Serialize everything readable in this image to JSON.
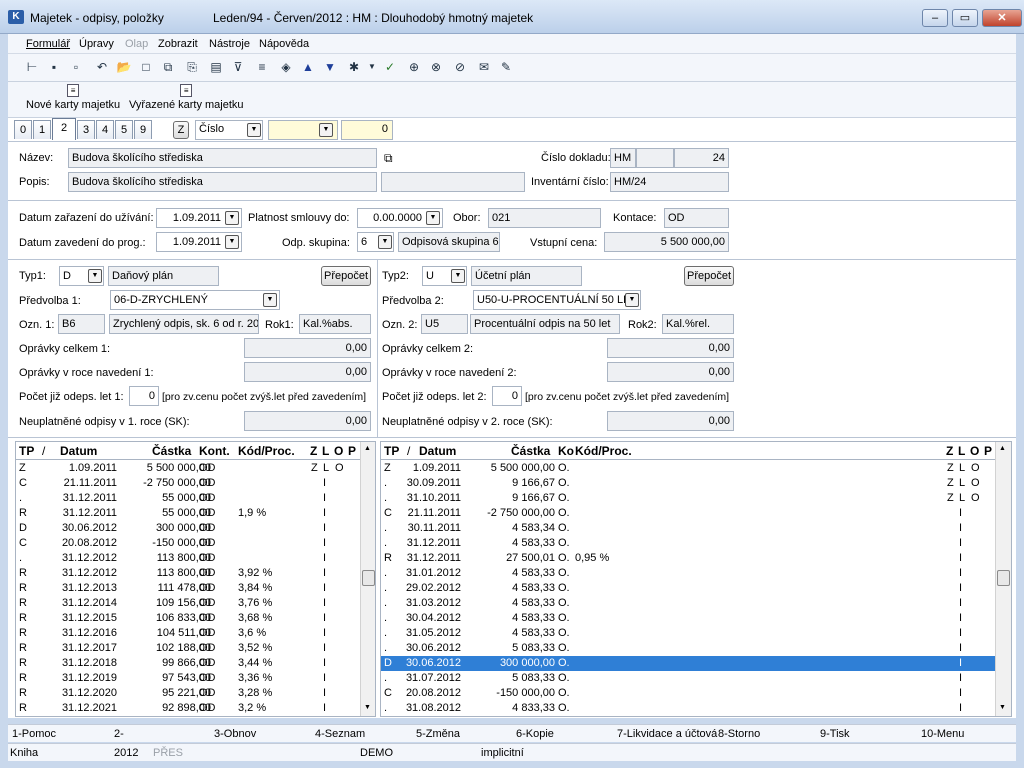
{
  "window": {
    "title": "Majetek - odpisy, položky",
    "subtitle": "Leden/94 - Červen/2012 : HM : Dlouhodobý hmotný majetek"
  },
  "menu": [
    "Formulář",
    "Úpravy",
    "Olap",
    "Zobrazit",
    "Nástroje",
    "Nápověda"
  ],
  "toolbar2": {
    "new_cards": "Nové karty majetku",
    "removed_cards": "Vyřazené karty majetku"
  },
  "tabs": [
    "0",
    "1",
    "2",
    "3",
    "4",
    "5",
    "9"
  ],
  "sortbar": {
    "z_button": "Z",
    "sort_field": "Číslo",
    "value": "0"
  },
  "header": {
    "nazev_label": "Název:",
    "nazev": "Budova školícího střediska",
    "popis_label": "Popis:",
    "popis": "Budova školícího střediska",
    "cislo_dokladu_label": "Číslo dokladu:",
    "cislo_dokladu_rada": "HM",
    "cislo_dokladu": "24",
    "inv_cislo_label": "Inventární číslo:",
    "inv_cislo": "HM/24"
  },
  "dates": {
    "zarazeni_label": "Datum zařazení do užívání:",
    "zarazeni": "1.09.2011",
    "zavedeni_label": "Datum zavedení do prog.:",
    "zavedeni": "1.09.2011",
    "platnost_label": "Platnost smlouvy do:",
    "platnost": "0.00.0000",
    "odp_skupina_label": "Odp. skupina:",
    "odp_skupina": "6",
    "odp_skupina_text": "Odpisová skupina 6 (",
    "obor_label": "Obor:",
    "obor": "021",
    "kontace_label": "Kontace:",
    "kontace": "OD",
    "vstupni_cena_label": "Vstupní cena:",
    "vstupni_cena": "5 500 000,00"
  },
  "plan1": {
    "typ_label": "Typ1:",
    "typ": "D",
    "typ_text": "Daňový plán",
    "prepocet": "Přepočet",
    "predvolba_label": "Předvolba 1:",
    "predvolba": "06-D-ZRYCHLENÝ",
    "ozn_label": "Ozn. 1:",
    "ozn": "B6",
    "ozn_text": "Zrychlený odpis, sk. 6 od r. 20",
    "rok_label": "Rok1:",
    "rok": "Kal.%abs.",
    "opravky_celkem_label": "Oprávky celkem 1:",
    "opravky_celkem": "0,00",
    "opravky_roce_label": "Oprávky v roce navedení 1:",
    "opravky_roce": "0,00",
    "pocet_let_label": "Počet již odeps. let 1:",
    "pocet_let": "0",
    "pocet_let_note": "[pro zv.cenu počet zvýš.let před zavedením]",
    "neuplatnene_label": "Neuplatněné odpisy v 1. roce (SK):",
    "neuplatnene": "0,00"
  },
  "plan2": {
    "typ_label": "Typ2:",
    "typ": "U",
    "typ_text": "Účetní plán",
    "prepocet": "Přepočet",
    "predvolba_label": "Předvolba 2:",
    "predvolba": "U50-U-PROCENTUÁLNÍ 50 LET",
    "ozn_label": "Ozn. 2:",
    "ozn": "U5",
    "ozn_text": "Procentuální odpis na 50 let",
    "rok_label": "Rok2:",
    "rok": "Kal.%rel.",
    "opravky_celkem_label": "Oprávky celkem 2:",
    "opravky_celkem": "0,00",
    "opravky_roce_label": "Oprávky v roce navedení 2:",
    "opravky_roce": "0,00",
    "pocet_let_label": "Počet již odeps. let 2:",
    "pocet_let": "0",
    "pocet_let_note": "[pro zv.cenu počet zvýš.let před zavedením]",
    "neuplatnene_label": "Neuplatněné odpisy v 2. roce (SK):",
    "neuplatnene": "0,00"
  },
  "grid1": {
    "columns": [
      "TP",
      "/",
      "Datum",
      "Částka",
      "Kont.",
      "Kód/Proc.",
      "Z",
      "L",
      "O",
      "P"
    ],
    "rows": [
      [
        "Z",
        "1.09.2011",
        "5 500 000,00",
        "OD",
        "",
        "Z",
        "L",
        "O",
        ""
      ],
      [
        "C",
        "21.11.2011",
        "-2 750 000,00",
        "OD",
        "",
        "",
        "I",
        "",
        ""
      ],
      [
        ".",
        "31.12.2011",
        "55 000,00",
        "OD",
        "",
        "",
        "I",
        "",
        ""
      ],
      [
        "R",
        "31.12.2011",
        "55 000,00",
        "OD",
        "1,9 %",
        "",
        "I",
        "",
        ""
      ],
      [
        "D",
        "30.06.2012",
        "300 000,00",
        "OD",
        "",
        "",
        "I",
        "",
        ""
      ],
      [
        "C",
        "20.08.2012",
        "-150 000,00",
        "OD",
        "",
        "",
        "I",
        "",
        ""
      ],
      [
        ".",
        "31.12.2012",
        "113 800,00",
        "OD",
        "",
        "",
        "I",
        "",
        ""
      ],
      [
        "R",
        "31.12.2012",
        "113 800,00",
        "OD",
        "3,92 %",
        "",
        "I",
        "",
        ""
      ],
      [
        "R",
        "31.12.2013",
        "111 478,00",
        "OD",
        "3,84 %",
        "",
        "I",
        "",
        ""
      ],
      [
        "R",
        "31.12.2014",
        "109 156,00",
        "OD",
        "3,76 %",
        "",
        "I",
        "",
        ""
      ],
      [
        "R",
        "31.12.2015",
        "106 833,00",
        "OD",
        "3,68 %",
        "",
        "I",
        "",
        ""
      ],
      [
        "R",
        "31.12.2016",
        "104 511,00",
        "OD",
        "3,6 %",
        "",
        "I",
        "",
        ""
      ],
      [
        "R",
        "31.12.2017",
        "102 188,00",
        "OD",
        "3,52 %",
        "",
        "I",
        "",
        ""
      ],
      [
        "R",
        "31.12.2018",
        "99 866,00",
        "OD",
        "3,44 %",
        "",
        "I",
        "",
        ""
      ],
      [
        "R",
        "31.12.2019",
        "97 543,00",
        "OD",
        "3,36 %",
        "",
        "I",
        "",
        ""
      ],
      [
        "R",
        "31.12.2020",
        "95 221,00",
        "OD",
        "3,28 %",
        "",
        "I",
        "",
        ""
      ],
      [
        "R",
        "31.12.2021",
        "92 898,00",
        "OD",
        "3,2 %",
        "",
        "I",
        "",
        ""
      ]
    ]
  },
  "grid2": {
    "columns": [
      "TP",
      "/",
      "Datum",
      "Částka",
      "Ko",
      "Kód/Proc.",
      "Z",
      "L",
      "O",
      "P"
    ],
    "selected_row": 13,
    "rows": [
      [
        "Z",
        "1.09.2011",
        "5 500 000,00",
        "O.",
        "",
        "Z",
        "L",
        "O",
        ""
      ],
      [
        ".",
        "30.09.2011",
        "9 166,67",
        "O.",
        "",
        "Z",
        "L",
        "O",
        ""
      ],
      [
        ".",
        "31.10.2011",
        "9 166,67",
        "O.",
        "",
        "Z",
        "L",
        "O",
        ""
      ],
      [
        "C",
        "21.11.2011",
        "-2 750 000,00",
        "O.",
        "",
        "",
        "I",
        "",
        ""
      ],
      [
        ".",
        "30.11.2011",
        "4 583,34",
        "O.",
        "",
        "",
        "I",
        "",
        ""
      ],
      [
        ".",
        "31.12.2011",
        "4 583,33",
        "O.",
        "",
        "",
        "I",
        "",
        ""
      ],
      [
        "R",
        "31.12.2011",
        "27 500,01",
        "O.",
        "0,95 %",
        "",
        "I",
        "",
        ""
      ],
      [
        ".",
        "31.01.2012",
        "4 583,33",
        "O.",
        "",
        "",
        "I",
        "",
        ""
      ],
      [
        ".",
        "29.02.2012",
        "4 583,33",
        "O.",
        "",
        "",
        "I",
        "",
        ""
      ],
      [
        ".",
        "31.03.2012",
        "4 583,33",
        "O.",
        "",
        "",
        "I",
        "",
        ""
      ],
      [
        ".",
        "30.04.2012",
        "4 583,33",
        "O.",
        "",
        "",
        "I",
        "",
        ""
      ],
      [
        ".",
        "31.05.2012",
        "4 583,33",
        "O.",
        "",
        "",
        "I",
        "",
        ""
      ],
      [
        ".",
        "30.06.2012",
        "5 083,33",
        "O.",
        "",
        "",
        "I",
        "",
        ""
      ],
      [
        "D",
        "30.06.2012",
        "300 000,00",
        "O.",
        "",
        "",
        "I",
        "",
        ""
      ],
      [
        ".",
        "31.07.2012",
        "5 083,33",
        "O.",
        "",
        "",
        "I",
        "",
        ""
      ],
      [
        "C",
        "20.08.2012",
        "-150 000,00",
        "O.",
        "",
        "",
        "I",
        "",
        ""
      ],
      [
        ".",
        "31.08.2012",
        "4 833,33",
        "O.",
        "",
        "",
        "I",
        "",
        ""
      ]
    ]
  },
  "fkeys": [
    "1-Pomoc",
    "2-",
    "3-Obnov",
    "4-Seznam",
    "5-Změna",
    "6-Kopie",
    "7-Likvidace a účtová",
    "8-Storno",
    "9-Tisk",
    "10-Menu"
  ],
  "status": {
    "module": "Kniha",
    "year": "2012",
    "mode": "PŘES",
    "db": "DEMO",
    "profile": "implicitní"
  }
}
